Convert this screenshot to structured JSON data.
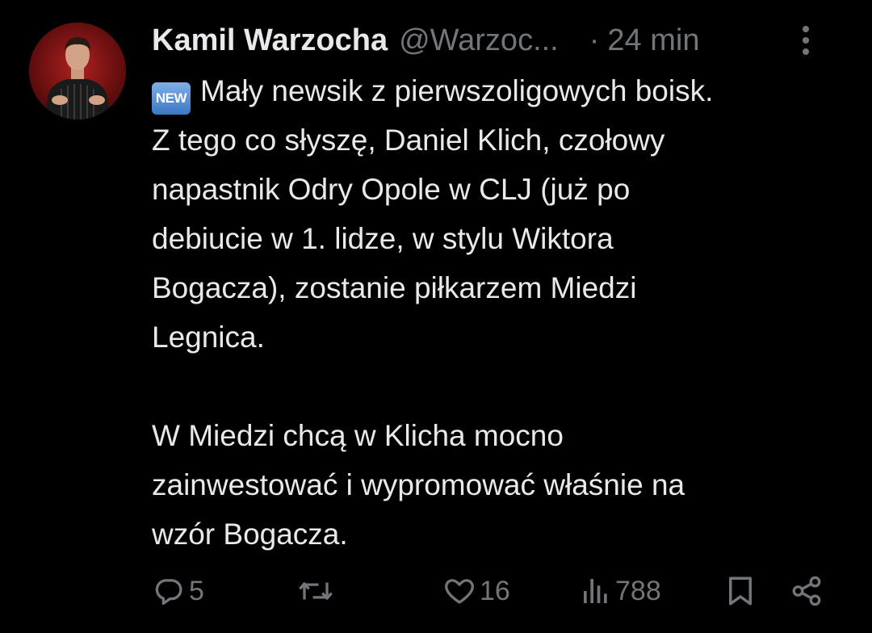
{
  "author": {
    "display_name": "Kamil Warzocha",
    "handle": "@Warzoc...",
    "avatar_icon": "profile-photo"
  },
  "meta": {
    "dot": "·",
    "time": "24 min"
  },
  "tweet": {
    "badge": "NEW",
    "lines": [
      "Mały newsik z pierwszoligowych boisk.",
      "Z tego co słyszę, Daniel Klich, czołowy",
      "napastnik Odry Opole w CLJ (już po",
      "debiucie w 1. lidze, w stylu Wiktora",
      "Bogacza), zostanie piłkarzem Miedzi",
      "Legnica.",
      "W Miedzi chcą w Klicha mocno",
      "zainwestować i wypromować właśnie na",
      "wzór Bogacza."
    ]
  },
  "actions": {
    "replies": "5",
    "retweets": "",
    "likes": "16",
    "views": "788"
  },
  "colors": {
    "background": "#000000",
    "text": "#e7e9ea",
    "muted": "#71767b"
  }
}
